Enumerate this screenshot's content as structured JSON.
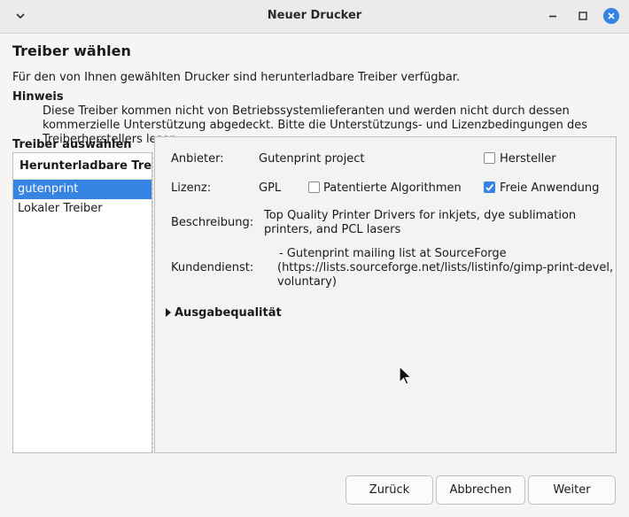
{
  "window": {
    "title": "Neuer Drucker"
  },
  "page": {
    "heading": "Treiber wählen",
    "description": "Für den von Ihnen gewählten Drucker sind herunterladbare Treiber verfügbar.",
    "hint_label": "Hinweis",
    "hint_text": "Diese Treiber kommen nicht von Betriebssystemlieferanten und werden nicht durch dessen kommerzielle Unterstützung abgedeckt. Bitte die Unterstützungs- und Lizenzbedingungen des Treiberherstellers lesen.",
    "select_label": "Treiber auswählen"
  },
  "driver_list": {
    "header": "Herunterladbare Treiber",
    "items": [
      {
        "label": "gutenprint",
        "selected": true
      },
      {
        "label": "Lokaler Treiber",
        "selected": false
      }
    ]
  },
  "details": {
    "vendor_label": "Anbieter:",
    "vendor_value": "Gutenprint project",
    "manufacturer_checkbox": {
      "label": "Hersteller",
      "checked": false
    },
    "license_label": "Lizenz:",
    "license_value": "GPL",
    "patented_checkbox": {
      "label": "Patentierte Algorithmen",
      "checked": false
    },
    "free_checkbox": {
      "label": "Freie Anwendung",
      "checked": true
    },
    "description_label": "Beschreibung:",
    "description_value": "Top Quality Printer Drivers for inkjets, dye sublimation printers, and PCL lasers",
    "support_label": "Kundendienst:",
    "support_value": "- Gutenprint mailing list at SourceForge (https://lists.sourceforge.net/lists/listinfo/gimp-print-devel, voluntary)",
    "output_quality_expander": "Ausgabequalität"
  },
  "buttons": {
    "back": "Zurück",
    "cancel": "Abbrechen",
    "next": "Weiter"
  },
  "colors": {
    "accent": "#3584e4"
  },
  "icons": {
    "menu": "chevron-down-icon",
    "minimize": "minimize-icon",
    "maximize": "maximize-icon",
    "close": "close-icon",
    "expander": "triangle-right-icon",
    "cursor": "mouse-pointer-icon"
  }
}
